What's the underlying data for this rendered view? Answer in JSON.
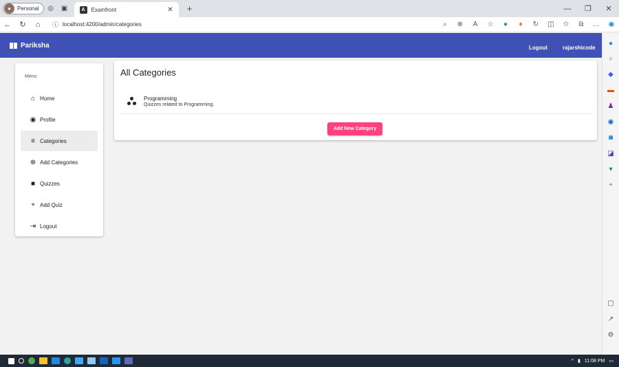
{
  "browser": {
    "profile_label": "Personal",
    "tab_title": "Examfront",
    "new_tab_glyph": "+",
    "url": "localhost:4200/admin/categories"
  },
  "toolbar": {
    "brand": "Pariksha",
    "logout_label": "Logout",
    "username": "rajarshicode"
  },
  "sidebar": {
    "menu_title": "Menu",
    "items": [
      {
        "label": "Home",
        "icon": "home-icon"
      },
      {
        "label": "Profile",
        "icon": "account-circle-icon"
      },
      {
        "label": "Categories",
        "icon": "list-icon",
        "active": true
      },
      {
        "label": "Add Categories",
        "icon": "add-circle-icon"
      },
      {
        "label": "Quizzes",
        "icon": "library-books-icon"
      },
      {
        "label": "Add Quiz",
        "icon": "plus-icon"
      },
      {
        "label": "Logout",
        "icon": "logout-icon"
      }
    ]
  },
  "main": {
    "title": "All Categories",
    "categories": [
      {
        "title": "Programming",
        "description": "Quizzes related to Programming."
      }
    ],
    "add_button_label": "Add New Category"
  },
  "taskbar": {
    "time": "11:08 PM"
  },
  "colors": {
    "primary": "#3f51b5",
    "accent": "#ff4081"
  }
}
